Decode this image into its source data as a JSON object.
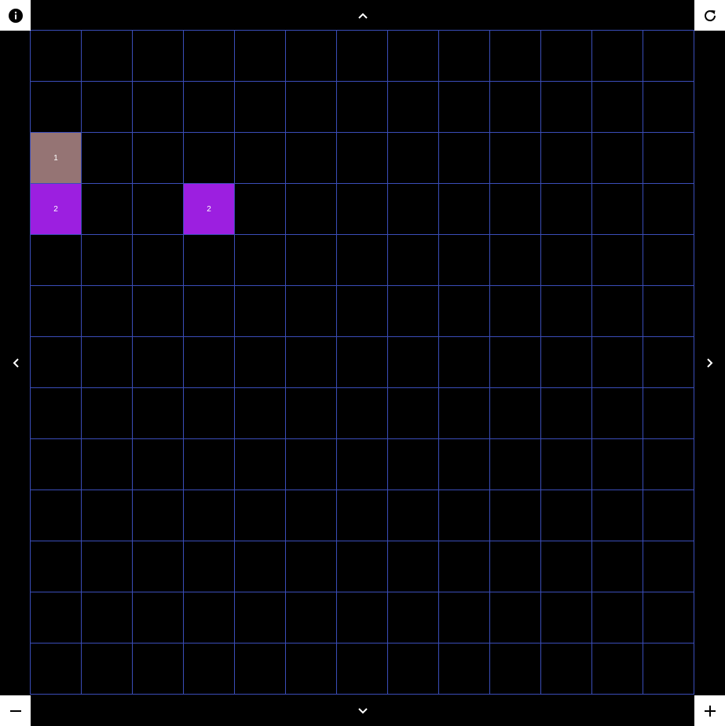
{
  "controls": {
    "info_icon": "info-icon",
    "reset_icon": "refresh-icon",
    "zoom_out_icon": "minus-icon",
    "zoom_in_icon": "plus-icon",
    "up_icon": "chevron-up-icon",
    "down_icon": "chevron-down-icon",
    "left_icon": "chevron-left-icon",
    "right_icon": "chevron-right-icon"
  },
  "board": {
    "rows": 13,
    "cols": 13,
    "grid_color": "#3a4db8",
    "background": "#000000",
    "cells": [
      {
        "row": 2,
        "col": 0,
        "value": "1",
        "color": "#957474"
      },
      {
        "row": 3,
        "col": 0,
        "value": "2",
        "color": "#9c1fe0"
      },
      {
        "row": 3,
        "col": 3,
        "value": "2",
        "color": "#9c1fe0"
      }
    ]
  }
}
